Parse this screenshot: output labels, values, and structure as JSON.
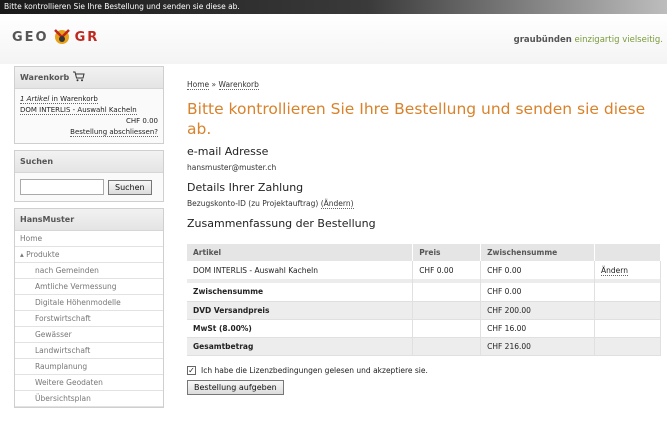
{
  "topbar": {
    "message": "Bitte kontrollieren Sie Ihre Bestellung und senden sie diese ab."
  },
  "header": {
    "logo_left": "GEO",
    "logo_right": "GR",
    "tagline_brand": "graubünden",
    "tagline_text": "einzigartig vielseitig."
  },
  "sidebar": {
    "cart": {
      "title": "Warenkorb",
      "count_text": "1 Artikel",
      "count_suffix": " in Warenkorb",
      "item": "DOM INTERLIS - Auswahl Kacheln",
      "price": "CHF 0.00",
      "checkout": "Bestellung abschliessen?"
    },
    "search": {
      "title": "Suchen",
      "placeholder": "",
      "button": "Suchen"
    },
    "user": {
      "title": "HansMuster",
      "nav": [
        "Home",
        "▴ Produkte",
        "nach Gemeinden",
        "Amtliche Vermessung",
        "Digitale Höhenmodelle",
        "Forstwirtschaft",
        "Gewässer",
        "Landwirtschaft",
        "Raumplanung",
        "Weitere Geodaten",
        "Übersichtsplan"
      ]
    }
  },
  "main": {
    "breadcrumb_home": "Home",
    "breadcrumb_sep": " » ",
    "breadcrumb_current": "Warenkorb",
    "title": "Bitte kontrollieren Sie Ihre Bestellung und senden sie diese ab.",
    "email_heading": "e-mail Adresse",
    "email": "hansmuster@muster.ch",
    "payment_heading": "Details Ihrer Zahlung",
    "payment_text": "Bezugskonto-ID (zu Projektauftrag)",
    "payment_change": "(Ändern)",
    "summary_heading": "Zusammenfassung der Bestellung",
    "table": {
      "headers": [
        "Artikel",
        "Preis",
        "Zwischensumme",
        ""
      ],
      "item": {
        "name": "DOM INTERLIS - Auswahl Kacheln",
        "price": "CHF 0.00",
        "subtotal": "CHF 0.00",
        "action": "Ändern"
      },
      "rows": [
        {
          "label": "Zwischensumme",
          "value": "CHF 0.00"
        },
        {
          "label": "DVD Versandpreis",
          "value": "CHF 200.00"
        },
        {
          "label": "MwSt (8.00%)",
          "value": "CHF 16.00"
        },
        {
          "label": "Gesamtbetrag",
          "value": "CHF 216.00"
        }
      ]
    },
    "agree_text": "Ich habe die Lizenzbedingungen gelesen und akzeptiere sie.",
    "submit": "Bestellung aufgeben"
  },
  "colors": {
    "accent": "#d9822b",
    "logo_red": "#c0281d",
    "tagline_green": "#7a9a3a"
  },
  "icons": {
    "cart": "shopping-cart-icon",
    "checkbox": "checkbox-checked-icon"
  }
}
